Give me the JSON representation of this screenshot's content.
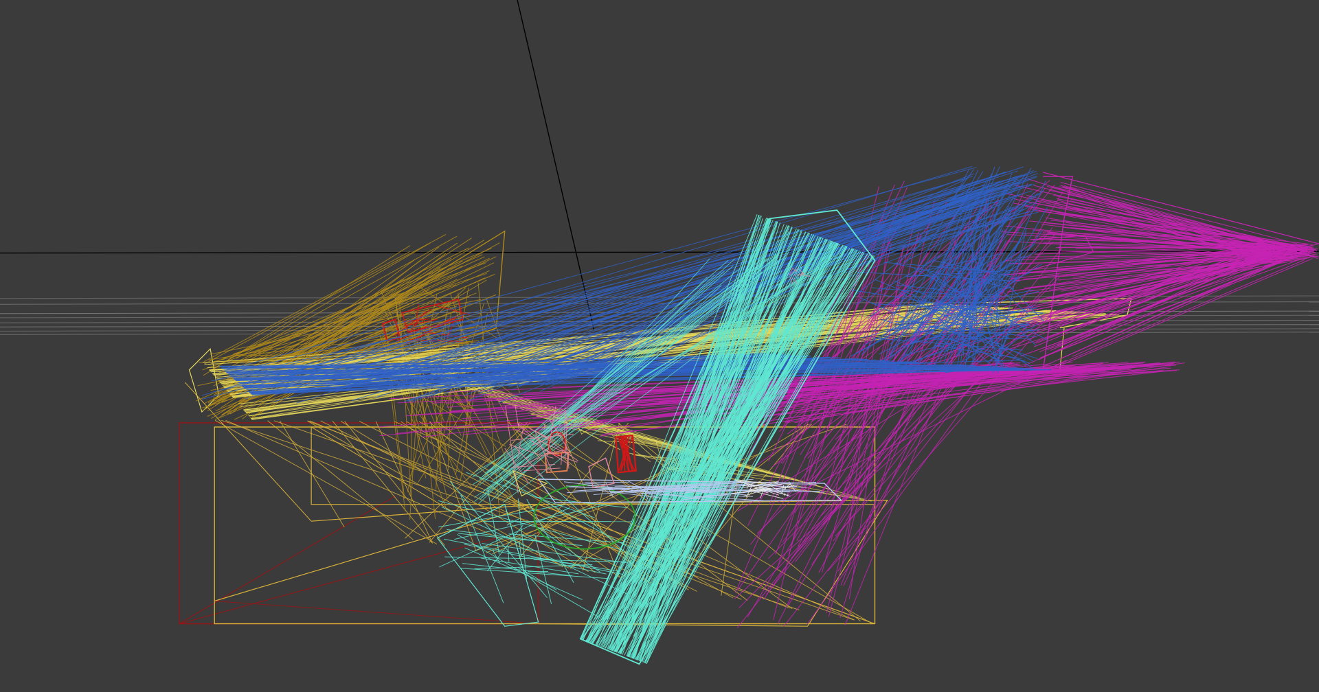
{
  "viewport": {
    "background": "#3b3b3b",
    "mode": "wireframe"
  },
  "colors": {
    "grid_main": "#000000",
    "grid_gray": "#8a8a8a",
    "olive": "#b08a1a",
    "gold": "#d8b13a",
    "yellow": "#e6d85a",
    "dark_red": "#8b1a1a",
    "red": "#d01818",
    "cyan": "#5fe8d2",
    "blue": "#2f62c8",
    "magenta": "#c623b4",
    "pink": "#e58aa0",
    "light_blue": "#b8c8ee",
    "green": "#2aa22a",
    "white": "#e8e8e8"
  },
  "objects": [
    {
      "name": "olive-structure",
      "color_key": "olive"
    },
    {
      "name": "gold-base-box",
      "color_key": "gold"
    },
    {
      "name": "dark-red-base-box",
      "color_key": "dark_red"
    },
    {
      "name": "cyan-tube",
      "color_key": "cyan"
    },
    {
      "name": "blue-fan",
      "color_key": "blue"
    },
    {
      "name": "magenta-fan",
      "color_key": "magenta"
    },
    {
      "name": "yellow-beams",
      "color_key": "yellow"
    },
    {
      "name": "center-props",
      "color_key": "red"
    }
  ]
}
